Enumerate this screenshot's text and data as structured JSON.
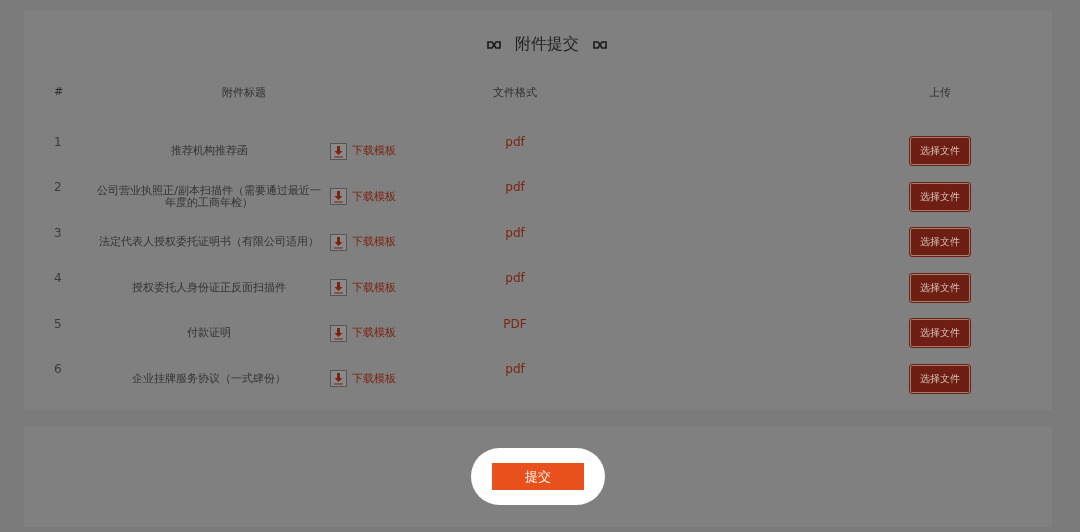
{
  "section": {
    "title": "附件提交"
  },
  "table": {
    "columns": [
      "#",
      "附件标题",
      "文件格式",
      "上传"
    ],
    "rows": [
      {
        "index": "1",
        "title": "推荐机构推荐函",
        "download": "下载模板",
        "format": "pdf",
        "upload": "选择文件"
      },
      {
        "index": "2",
        "title": "公司营业执照正/副本扫描件（需要通过最近一年度的工商年检）",
        "download": "下载模板",
        "format": "pdf",
        "upload": "选择文件"
      },
      {
        "index": "3",
        "title": "法定代表人授权委托证明书（有限公司适用）",
        "download": "下载模板",
        "format": "pdf",
        "upload": "选择文件"
      },
      {
        "index": "4",
        "title": "授权委托人身份证正反面扫描件",
        "download": "下载模板",
        "format": "pdf",
        "upload": "选择文件"
      },
      {
        "index": "5",
        "title": "付款证明",
        "download": "下载模板",
        "format": "PDF",
        "upload": "选择文件"
      },
      {
        "index": "6",
        "title": "企业挂牌服务协议（一式肆份）",
        "download": "下载模板",
        "format": "pdf",
        "upload": "选择文件"
      }
    ]
  },
  "submit": {
    "label": "提交"
  }
}
